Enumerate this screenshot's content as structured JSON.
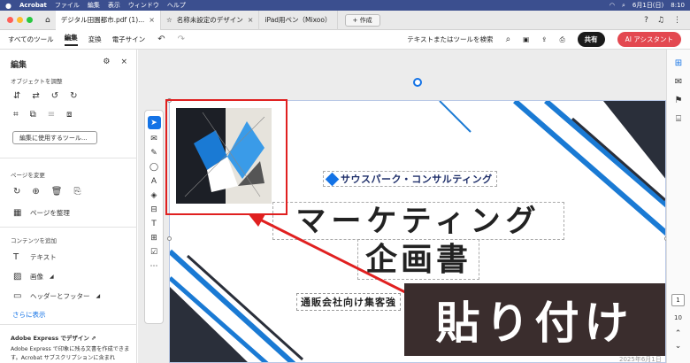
{
  "menubar": {
    "app": "Acrobat",
    "items": [
      "ファイル",
      "編集",
      "表示",
      "ウィンドウ",
      "ヘルプ"
    ],
    "date_time": "6月1日(日)",
    "clock": "8:10"
  },
  "tabs": [
    {
      "label": "デジタル田園都市.pdf (1)...",
      "active": true
    },
    {
      "label": "名称未設定のデザイン",
      "active": false
    },
    {
      "label": "iPad用ペン（Mixoo）",
      "active": false
    }
  ],
  "new_tab_label": "+ 作成",
  "toolbar": {
    "all_tools": "すべてのツール",
    "edit": "編集",
    "convert": "変換",
    "esign": "電子サイン",
    "search_placeholder": "テキストまたはツールを検索",
    "share": "共有",
    "ai": "AI アシスタント"
  },
  "panel": {
    "title": "編集",
    "adjust_objects": "オブジェクトを調整",
    "edit_tools_btn": "編集に使用するツール...",
    "change_pages": "ページを変更",
    "organize_pages": "ページを整理",
    "add_content": "コンテンツを追加",
    "text": "テキスト",
    "image": "画像",
    "header_footer": "ヘッダーとフッター",
    "more": "さらに表示",
    "adobe_express": "Adobe Express でデザイン",
    "express_desc": "Adobe Express で印象に残る文書を作成できます。Acrobat サブスクリプションに含まれ"
  },
  "slide": {
    "company": "サウスパーク・コンサルティング",
    "title_line1": "マーケティング",
    "title_line2": "企画書",
    "subtitle": "通販会社向け集客強",
    "date": "2025年6月1日"
  },
  "overlay_caption": "貼り付け",
  "pages": {
    "current": "1",
    "total": "10"
  },
  "colors": {
    "accent": "#1473e6",
    "highlight": "#e02020",
    "ai": "#e34850"
  }
}
